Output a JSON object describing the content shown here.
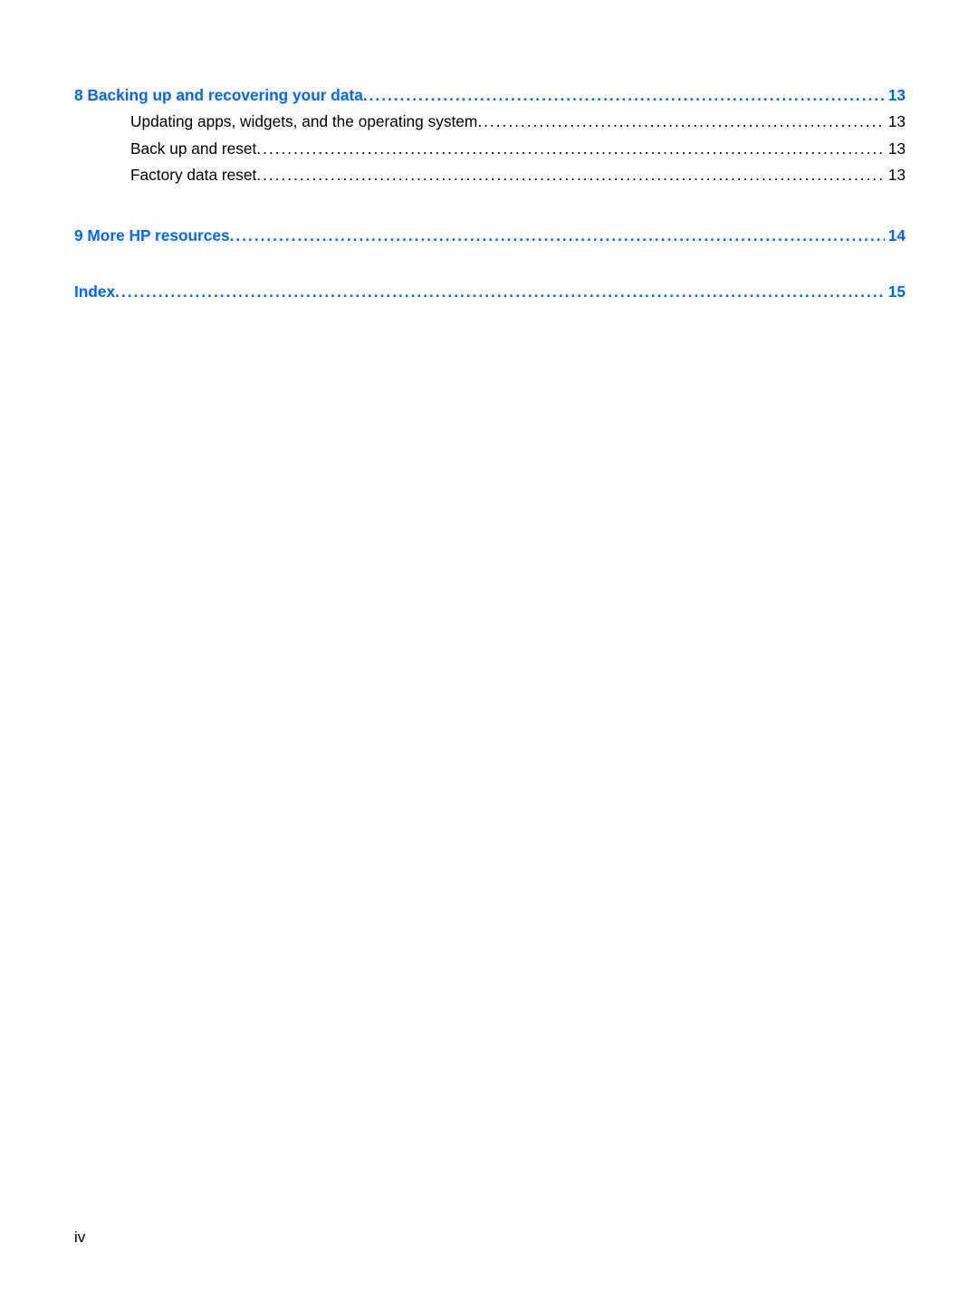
{
  "toc": {
    "section8": {
      "title": "8  Backing up and recovering your data",
      "page": "13",
      "children": [
        {
          "title": "Updating apps, widgets, and the operating system",
          "page": "13"
        },
        {
          "title": "Back up and reset",
          "page": "13"
        },
        {
          "title": "Factory data reset",
          "page": "13"
        }
      ]
    },
    "section9": {
      "title": "9  More HP resources",
      "page": "14"
    },
    "index": {
      "title": "Index",
      "page": "15"
    }
  },
  "pageNumber": "iv"
}
